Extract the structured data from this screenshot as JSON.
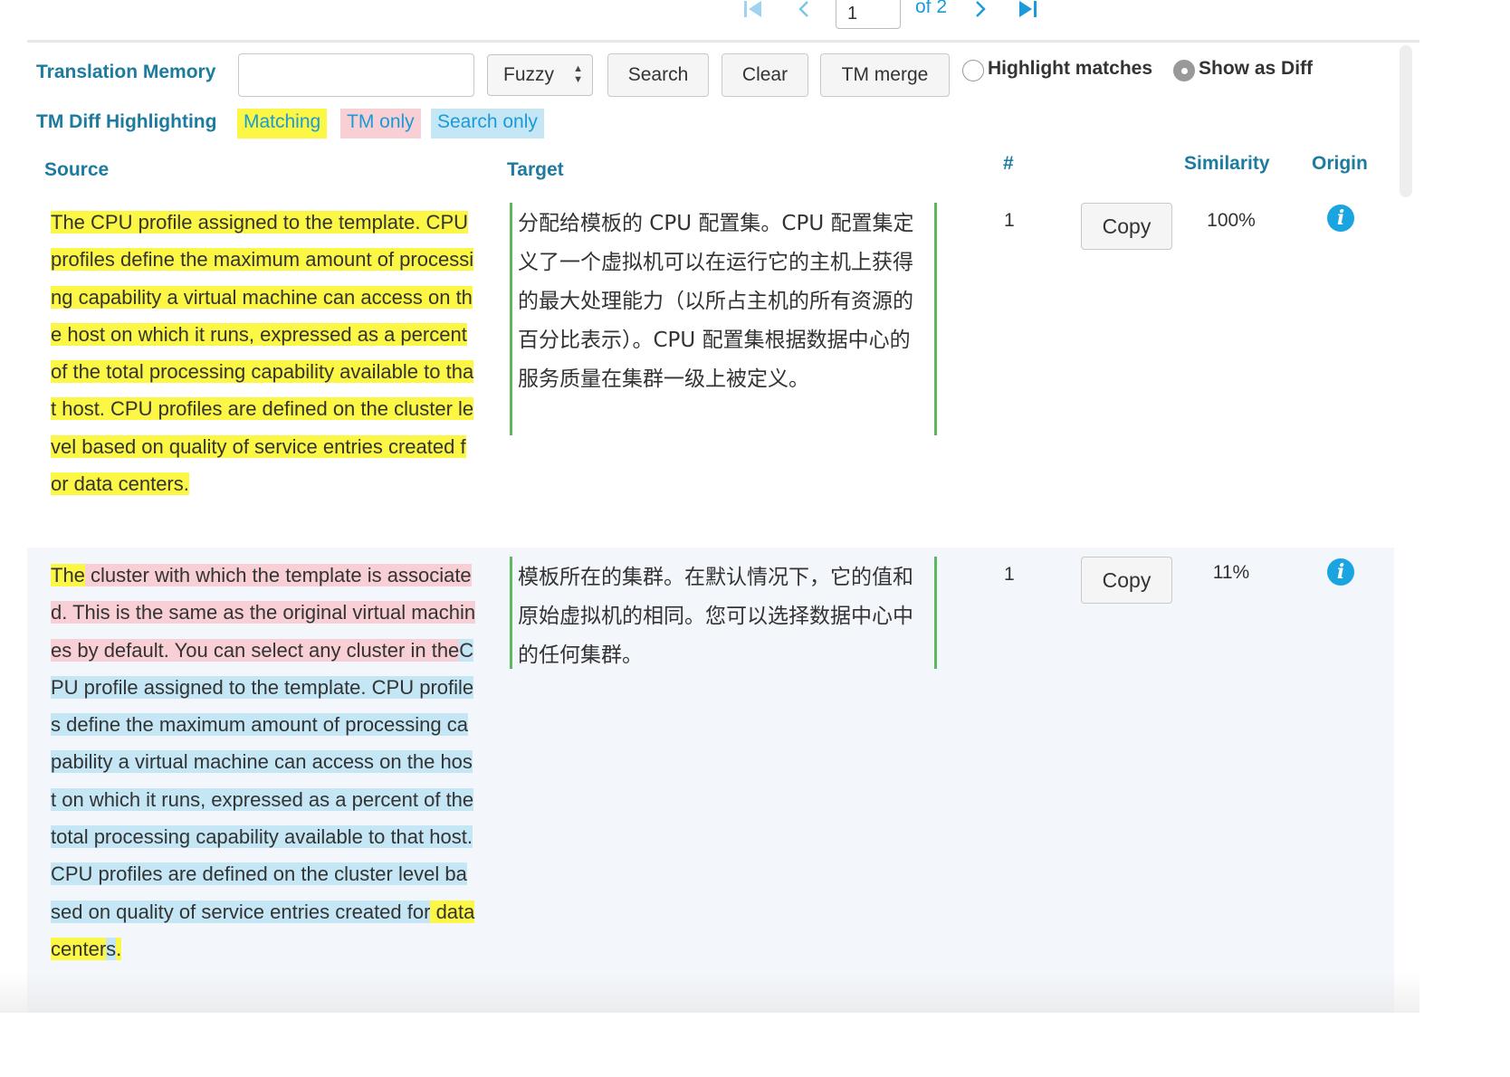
{
  "pagination": {
    "page_value": "1",
    "of_label": "of 2",
    "first_icon": "first-page-icon",
    "prev_icon": "chevron-left-icon",
    "next_icon": "chevron-right-icon",
    "last_icon": "last-page-icon"
  },
  "toolbar": {
    "title": "Translation Memory",
    "search_value": "",
    "mode_select": "Fuzzy",
    "search_button": "Search",
    "clear_button": "Clear",
    "merge_button": "TM merge",
    "radio_highlight": "Highlight matches",
    "radio_diff": "Show as Diff",
    "selected_radio": "Show as Diff"
  },
  "legend": {
    "title": "TM Diff Highlighting",
    "matching": "Matching",
    "tm_only": "TM only",
    "search_only": "Search only",
    "colors": {
      "matching": "#fbf744",
      "tm_only": "#f8cfd4",
      "search_only": "#c5e6f5"
    }
  },
  "columns": {
    "source": "Source",
    "target": "Target",
    "count": "#",
    "similarity": "Similarity",
    "origin": "Origin"
  },
  "rows": [
    {
      "source_segments": [
        {
          "type": "matching",
          "text": "The CPU profile assigned to the template. CPU profiles define the maximum amount of processing capability a virtual machine can access on the host on which it runs, expressed as a percent of the total processing capability available to that host. CPU profiles are defined on the cluster level based on quality of service entries created for data centers."
        }
      ],
      "target": "分配给模板的 CPU 配置集。CPU 配置集定义了一个虚拟机可以在运行它的主机上获得的最大处理能力（以所占主机的所有资源的百分比表示）。CPU 配置集根据数据中心的服务质量在集群一级上被定义。",
      "count": "1",
      "copy_label": "Copy",
      "similarity": "100%",
      "origin_icon": "info-icon"
    },
    {
      "source_segments": [
        {
          "type": "matching",
          "text": "The"
        },
        {
          "type": "tm_only",
          "text": " cluster with which the template is associated. This is the same as the original virtual machines by default. You can select any cluster in the"
        },
        {
          "type": "search_only",
          "text": "CPU profile assigned to the template. CPU profiles define the maximum amount of processing capability a virtual machine can access on the host on which it runs, expressed as a percent of the total processing capability available to that host. CPU profiles are defined on the cluster level based on quality of service entries created for"
        },
        {
          "type": "matching",
          "text": " data center"
        },
        {
          "type": "search_only",
          "text": "s"
        },
        {
          "type": "matching",
          "text": "."
        }
      ],
      "target": "模板所在的集群。在默认情况下，它的值和原始虚拟机的相同。您可以选择数据中心中的任何集群。",
      "count": "1",
      "copy_label": "Copy",
      "similarity": "11%",
      "origin_icon": "info-icon"
    }
  ]
}
